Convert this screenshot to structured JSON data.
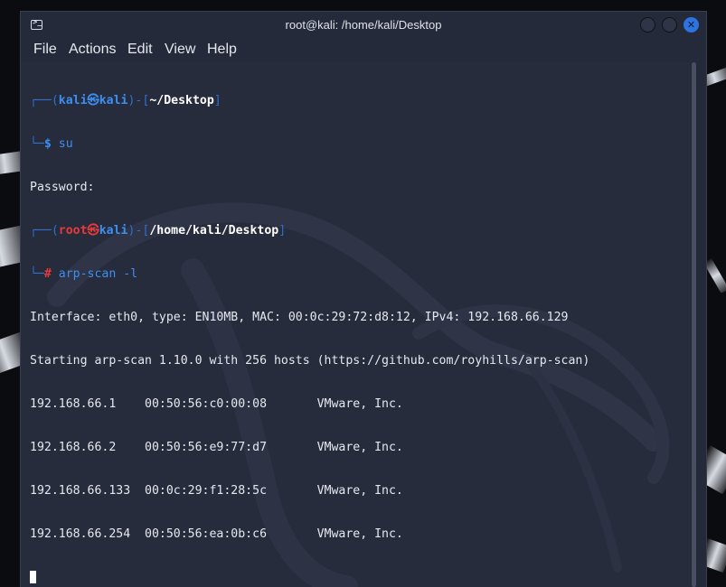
{
  "window": {
    "title": "root@kali: /home/kali/Desktop",
    "close_glyph": "✕",
    "app_icon_glyph": ">_"
  },
  "menu": {
    "file": "File",
    "actions": "Actions",
    "edit": "Edit",
    "view": "View",
    "help": "Help"
  },
  "terminal": {
    "prompt1": {
      "corner_top": "┌──(",
      "user": "kali",
      "at": "㉿",
      "host": "kali",
      "mid": ")-[",
      "cwd": "~/Desktop",
      "close": "]",
      "corner_bottom": "└─",
      "symbol": "$",
      "command": "su"
    },
    "password_line": "Password:",
    "prompt2": {
      "corner_top": "┌──(",
      "user": "root",
      "at": "㉿",
      "host": "kali",
      "mid": ")-[",
      "cwd": "/home/kali/Desktop",
      "close": "]",
      "corner_bottom": "└─",
      "symbol": "#",
      "command": "arp-scan -l"
    },
    "output": [
      "Interface: eth0, type: EN10MB, MAC: 00:0c:29:72:d8:12, IPv4: 192.168.66.129",
      "Starting arp-scan 1.10.0 with 256 hosts (https://github.com/royhills/arp-scan)",
      "192.168.66.1    00:50:56:c0:00:08       VMware, Inc.",
      "192.168.66.2    00:50:56:e9:77:d7       VMware, Inc.",
      "192.168.66.133  00:0c:29:f1:28:5c       VMware, Inc.",
      "192.168.66.254  00:50:56:ea:0b:c6       VMware, Inc."
    ]
  },
  "colors": {
    "terminal_bg": "#272c3c",
    "prompt_blue": "#3d8ef0",
    "root_red": "#e83a3a",
    "text": "#e5e8ef",
    "close_button": "#2d74e0"
  }
}
